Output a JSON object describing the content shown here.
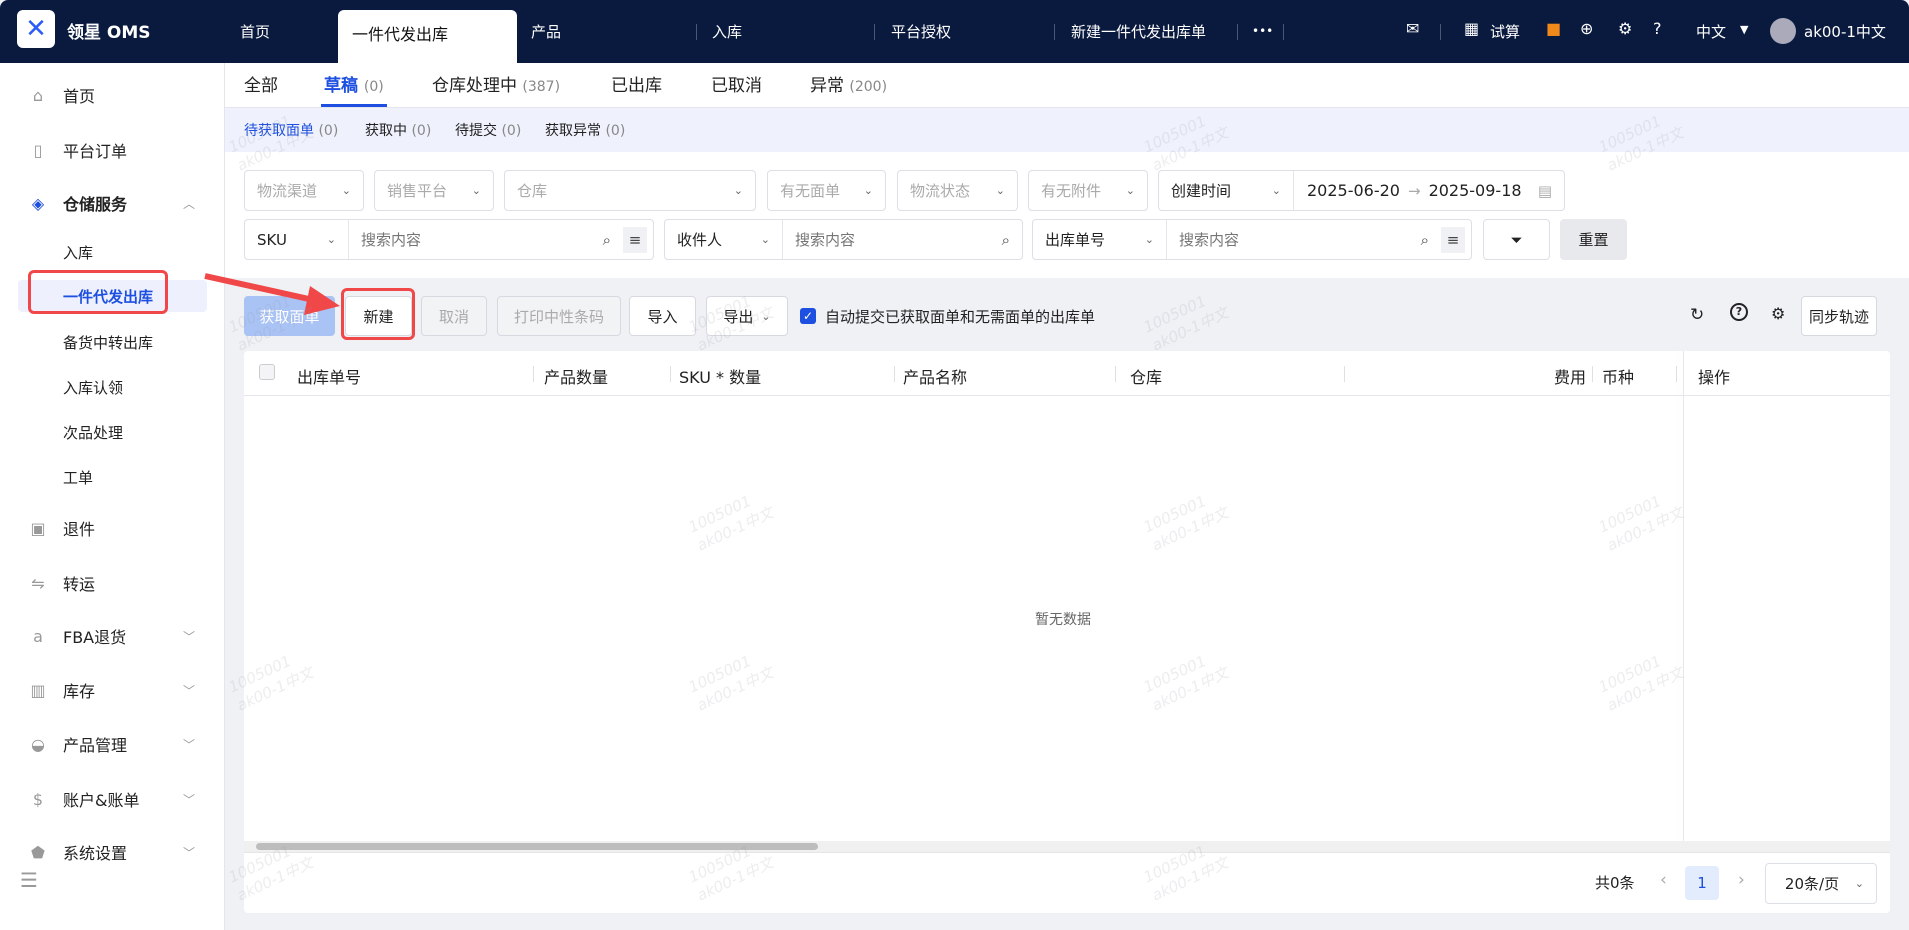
{
  "header": {
    "brand": "领星 OMS",
    "tabs": [
      "首页",
      "一件代发出库",
      "产品",
      "入库",
      "平台授权",
      "新建一件代发出库单"
    ],
    "more": "•••",
    "trial": "试算",
    "lang": "中文",
    "user": "ak00-1中文"
  },
  "sidebar": {
    "items": [
      {
        "label": "首页",
        "icon": "home-icon"
      },
      {
        "label": "平台订单",
        "icon": "clipboard-icon"
      },
      {
        "label": "仓储服务",
        "icon": "warehouse-icon"
      },
      {
        "label": "入库"
      },
      {
        "label": "一件代发出库"
      },
      {
        "label": "备货中转出库"
      },
      {
        "label": "入库认领"
      },
      {
        "label": "次品处理"
      },
      {
        "label": "工单"
      },
      {
        "label": "退件",
        "icon": "return-box-icon"
      },
      {
        "label": "转运",
        "icon": "transfer-icon"
      },
      {
        "label": "FBA退货",
        "icon": "amazon-icon"
      },
      {
        "label": "库存",
        "icon": "inventory-icon"
      },
      {
        "label": "产品管理",
        "icon": "product-icon"
      },
      {
        "label": "账户&账单",
        "icon": "bill-icon"
      },
      {
        "label": "系统设置",
        "icon": "settings-icon"
      }
    ]
  },
  "status_tabs": [
    {
      "label": "全部",
      "count": ""
    },
    {
      "label": "草稿",
      "count": "(0)"
    },
    {
      "label": "仓库处理中",
      "count": "(387)"
    },
    {
      "label": "已出库",
      "count": ""
    },
    {
      "label": "已取消",
      "count": ""
    },
    {
      "label": "异常",
      "count": "(200)"
    }
  ],
  "sub_tabs": [
    {
      "label": "待获取面单",
      "count": "(0)"
    },
    {
      "label": "获取中",
      "count": "(0)"
    },
    {
      "label": "待提交",
      "count": "(0)"
    },
    {
      "label": "获取异常",
      "count": "(0)"
    }
  ],
  "filters": {
    "logistics_channel": "物流渠道",
    "sales_platform": "销售平台",
    "warehouse": "仓库",
    "has_label": "有无面单",
    "logistics_status": "物流状态",
    "has_attachment": "有无附件",
    "time_type": "创建时间",
    "date_start": "2025-06-20",
    "date_end": "2025-09-18",
    "sku_type": "SKU",
    "search_placeholder": "搜索内容",
    "recipient_type": "收件人",
    "order_type": "出库单号",
    "reset": "重置"
  },
  "toolbar": {
    "get_label": "获取面单",
    "new": "新建",
    "cancel": "取消",
    "print": "打印中性条码",
    "import": "导入",
    "export": "导出",
    "auto_submit": "自动提交已获取面单和无需面单的出库单",
    "auto_submit_checked": true,
    "sync": "同步轨迹"
  },
  "table": {
    "columns": [
      "出库单号",
      "产品数量",
      "SKU * 数量",
      "产品名称",
      "仓库",
      "费用",
      "币种",
      "操作"
    ],
    "empty": "暂无数据"
  },
  "pagination": {
    "total": "共0条",
    "page": "1",
    "page_size": "20条/页"
  },
  "watermark": {
    "line1": "1005001",
    "line2": "ak00-1中文"
  },
  "colors": {
    "primary": "#1d4fe0",
    "header_bg": "#0a1a3e",
    "highlight": "#f04848"
  }
}
